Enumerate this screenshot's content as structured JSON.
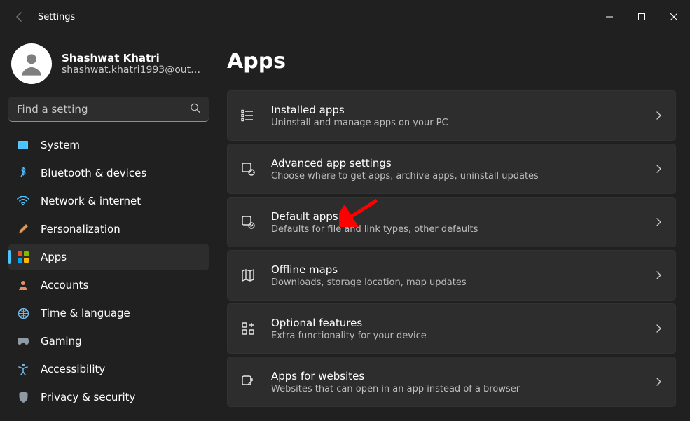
{
  "window": {
    "title": "Settings"
  },
  "profile": {
    "name": "Shashwat Khatri",
    "email": "shashwat.khatri1993@out…"
  },
  "search": {
    "placeholder": "Find a setting"
  },
  "nav": {
    "items": [
      {
        "label": "System"
      },
      {
        "label": "Bluetooth & devices"
      },
      {
        "label": "Network & internet"
      },
      {
        "label": "Personalization"
      },
      {
        "label": "Apps"
      },
      {
        "label": "Accounts"
      },
      {
        "label": "Time & language"
      },
      {
        "label": "Gaming"
      },
      {
        "label": "Accessibility"
      },
      {
        "label": "Privacy & security"
      }
    ],
    "selected": "Apps"
  },
  "page": {
    "title": "Apps",
    "cards": [
      {
        "title": "Installed apps",
        "sub": "Uninstall and manage apps on your PC"
      },
      {
        "title": "Advanced app settings",
        "sub": "Choose where to get apps, archive apps, uninstall updates"
      },
      {
        "title": "Default apps",
        "sub": "Defaults for file and link types, other defaults"
      },
      {
        "title": "Offline maps",
        "sub": "Downloads, storage location, map updates"
      },
      {
        "title": "Optional features",
        "sub": "Extra functionality for your device"
      },
      {
        "title": "Apps for websites",
        "sub": "Websites that can open in an app instead of a browser"
      }
    ]
  },
  "annotation": {
    "arrow_target": "Default apps",
    "arrow_color": "#ff0000"
  }
}
